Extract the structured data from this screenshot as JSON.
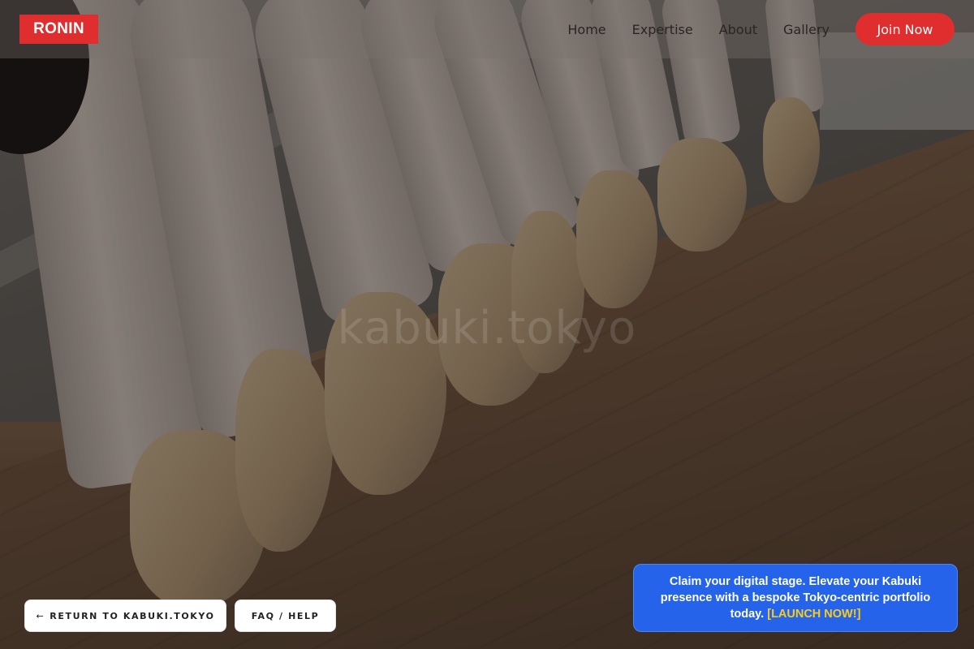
{
  "header": {
    "logo": "RONIN",
    "nav": [
      {
        "label": "Home"
      },
      {
        "label": "Expertise"
      },
      {
        "label": "About"
      },
      {
        "label": "Gallery"
      }
    ],
    "join_label": "Join Now"
  },
  "hero": {
    "watermark": "kabuki.tokyo"
  },
  "footer_buttons": {
    "return_arrow": "←",
    "return_label": "RETURN TO KABUKI.TOKYO",
    "faq_label": "FAQ / HELP"
  },
  "promo": {
    "text": "Claim your digital stage. Elevate your Kabuki presence with a bespoke Tokyo-centric portfolio today.",
    "cta": "[LAUNCH NOW!]"
  },
  "colors": {
    "brand_red": "#e02d2d",
    "promo_blue": "#2563eb",
    "cta_yellow": "#facc15"
  },
  "icons": [
    "left-arrow-icon"
  ]
}
